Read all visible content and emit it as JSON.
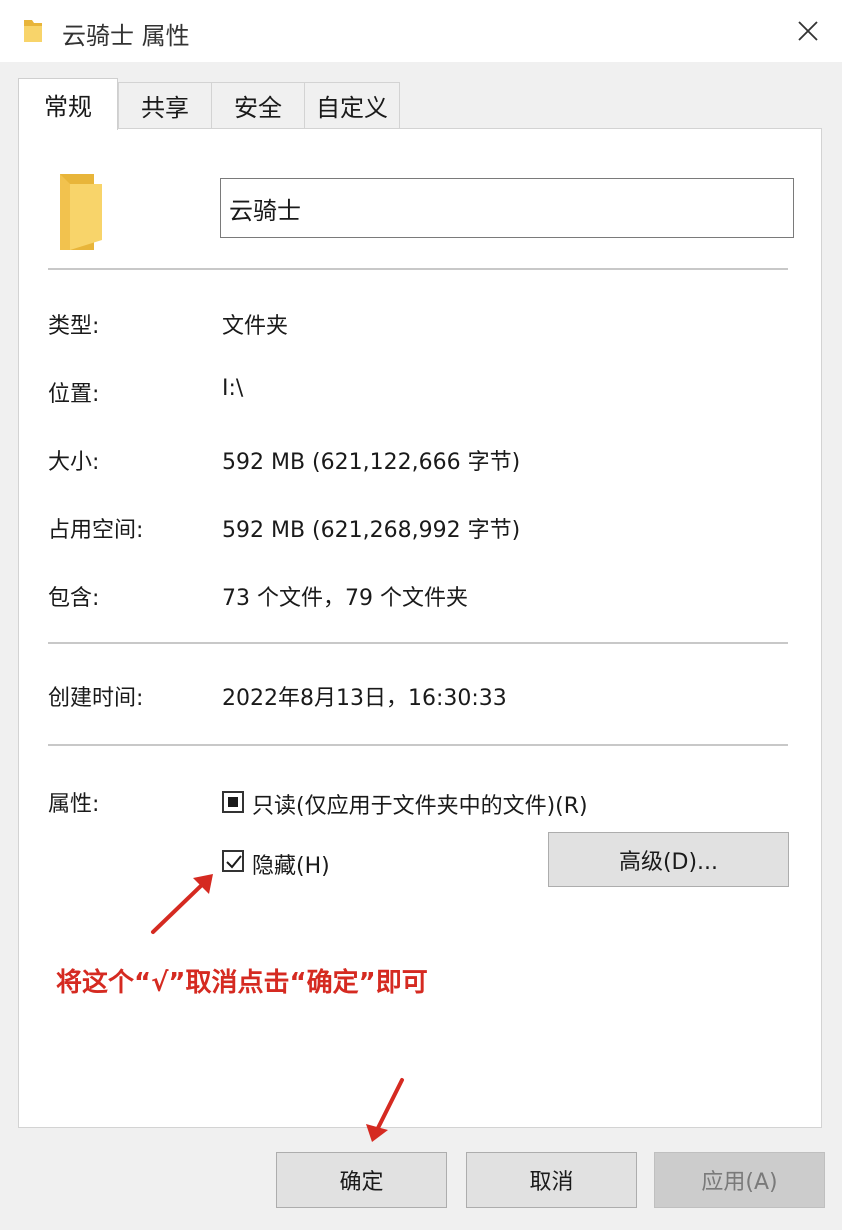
{
  "window": {
    "title": "云骑士 属性",
    "close_icon": "close-icon"
  },
  "tabs": [
    {
      "label": "常规",
      "active": true
    },
    {
      "label": "共享",
      "active": false
    },
    {
      "label": "安全",
      "active": false
    },
    {
      "label": "自定义",
      "active": false
    }
  ],
  "general": {
    "name": "云骑士",
    "rows": [
      {
        "label": "类型:",
        "value": "文件夹"
      },
      {
        "label": "位置:",
        "value": "I:\\"
      },
      {
        "label": "大小:",
        "value": "592 MB (621,122,666 字节)"
      },
      {
        "label": "占用空间:",
        "value": "592 MB (621,268,992 字节)"
      },
      {
        "label": "包含:",
        "value": "73 个文件，79 个文件夹"
      }
    ],
    "created": {
      "label": "创建时间:",
      "value": "2022年8月13日，16:30:33"
    },
    "attributes": {
      "label": "属性:",
      "readonly": {
        "label": "只读(仅应用于文件夹中的文件)(R)",
        "state": "indeterminate"
      },
      "hidden": {
        "label": "隐藏(H)",
        "checked": true
      },
      "advanced_button": "高级(D)..."
    }
  },
  "annotation": {
    "text": "将这个“√”取消点击“确定”即可",
    "color": "#d52a21"
  },
  "buttons": {
    "ok": "确定",
    "cancel": "取消",
    "apply": "应用(A)"
  },
  "colors": {
    "folder_yellow": "#f5c94a",
    "annotation_red": "#d52a21"
  }
}
